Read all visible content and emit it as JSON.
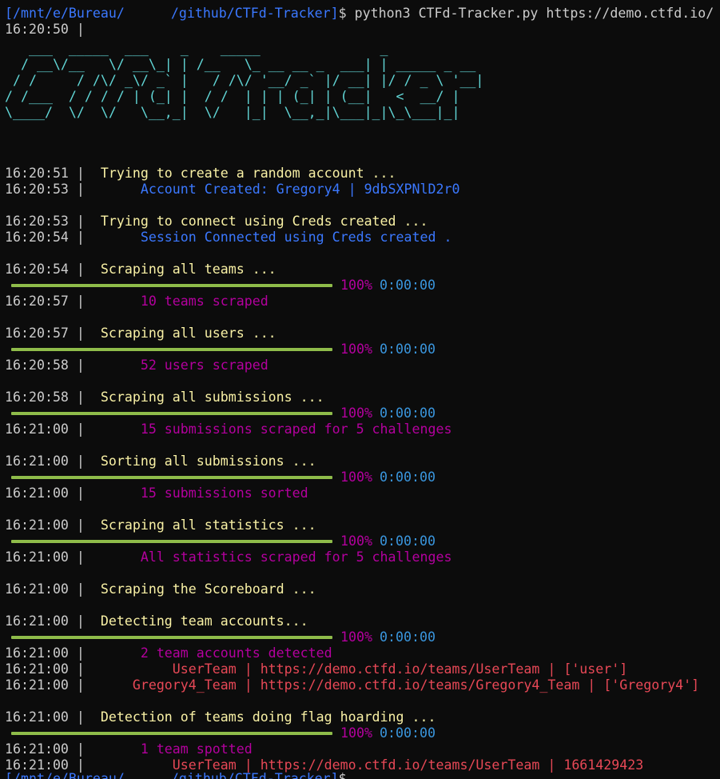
{
  "prompt": {
    "path_start": "[/mnt/e/Bureau/",
    "path_end": "/github/CTFd-Tracker]",
    "symbol": "$",
    "command": " python3 CTFd-Tracker.py https://demo.ctfd.io/"
  },
  "first_time": "16:20:50 |",
  "banner": [
    "   ___  _____  ___    _    _____               _",
    "  / __\\/__   \\/ __\\_| | /__   \\_ __ __ _  ___| | _____ _ __",
    " / /     / /\\/ _\\/ _` |   / /\\/ '__/ _` |/ __| |/ / _ \\ '__|",
    "/ /___  / / / / | (_| |  / /  | | | (_| | (__|   <  __/ |",
    "\\____/  \\/  \\/   \\__,_|  \\/   |_|  \\__,_|\\___|_|\\_\\___|_|"
  ],
  "progress": {
    "percent_label": "100%",
    "eta": "0:00:00",
    "percent": 100
  },
  "log": {
    "l1": {
      "time": "16:20:51 |",
      "msg": "  Trying to create a random account ..."
    },
    "l2": {
      "time": "16:20:53 |",
      "msg": "       Account Created: Gregory4 | 9dbSXPNlD2r0"
    },
    "l3": {
      "time": "16:20:53 |",
      "msg": "  Trying to connect using Creds created ..."
    },
    "l4": {
      "time": "16:20:54 |",
      "msg": "       Session Connected using Creds created ."
    },
    "l5": {
      "time": "16:20:54 |",
      "msg": "  Scraping all teams ..."
    },
    "l6": {
      "time": "16:20:57 |",
      "msg": "       10 teams scraped"
    },
    "l7": {
      "time": "16:20:57 |",
      "msg": "  Scraping all users ..."
    },
    "l8": {
      "time": "16:20:58 |",
      "msg": "       52 users scraped"
    },
    "l9": {
      "time": "16:20:58 |",
      "msg": "  Scraping all submissions ..."
    },
    "l10": {
      "time": "16:21:00 |",
      "msg": "       15 submissions scraped for 5 challenges"
    },
    "l11": {
      "time": "16:21:00 |",
      "msg": "  Sorting all submissions ..."
    },
    "l12": {
      "time": "16:21:00 |",
      "msg": "       15 submissions sorted"
    },
    "l13": {
      "time": "16:21:00 |",
      "msg": "  Scraping all statistics ..."
    },
    "l14": {
      "time": "16:21:00 |",
      "msg": "       All statistics scraped for 5 challenges"
    },
    "l15": {
      "time": "16:21:00 |",
      "msg": "  Scraping the Scoreboard ..."
    },
    "l16": {
      "time": "16:21:00 |",
      "msg": "  Detecting team accounts..."
    },
    "l17": {
      "time": "16:21:00 |",
      "msg": "       2 team accounts detected"
    },
    "l18": {
      "time": "16:21:00 |",
      "msg": "           UserTeam | https://demo.ctfd.io/teams/UserTeam | ['user']"
    },
    "l19": {
      "time": "16:21:00 |",
      "msg": "      Gregory4_Team | https://demo.ctfd.io/teams/Gregory4_Team | ['Gregory4']"
    },
    "l20": {
      "time": "16:21:00 |",
      "msg": "  Detection of teams doing flag hoarding ..."
    },
    "l21": {
      "time": "16:21:00 |",
      "msg": "       1 team spotted"
    },
    "l22": {
      "time": "16:21:00 |",
      "msg": "           UserTeam | https://demo.ctfd.io/teams/UserTeam | 1661429423"
    }
  },
  "bottom_prompt": {
    "path_start": "[/mnt/e/Bureau/",
    "path_end": "/github/CTFd-Tracker]",
    "symbol": "$"
  },
  "colors": {
    "background": "#0c0c0c",
    "path": "#3b78ff",
    "status": "#f9f1a5",
    "success": "#3b78ff",
    "result": "#b4009e",
    "detail": "#e74856",
    "banner": "#61d6d6",
    "bar": "#8fbc4a",
    "eta": "#3a96dd"
  }
}
